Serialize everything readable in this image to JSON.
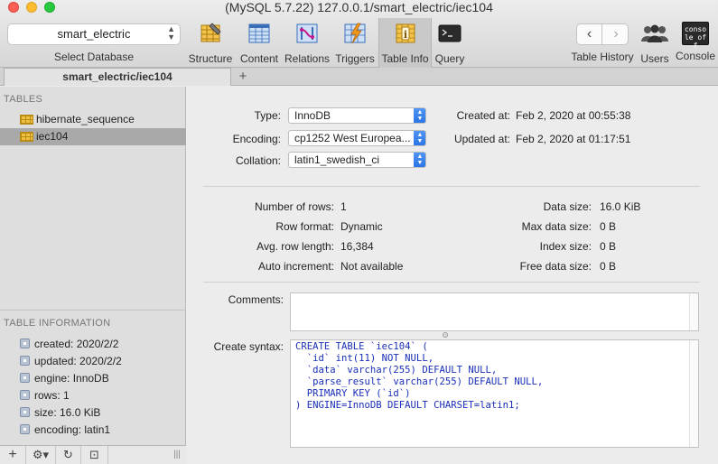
{
  "window": {
    "title": "(MySQL 5.7.22) 127.0.0.1/smart_electric/iec104"
  },
  "toolbar": {
    "database_value": "smart_electric",
    "database_caption": "Select Database",
    "items": {
      "structure": "Structure",
      "content": "Content",
      "relations": "Relations",
      "triggers": "Triggers",
      "table_info": "Table Info",
      "query": "Query",
      "table_history": "Table History",
      "users": "Users",
      "console": "Console"
    },
    "console_icon_text": "conso le off"
  },
  "tabs": {
    "active_label": "smart_electric/iec104",
    "add_label": "+"
  },
  "sidebar": {
    "tables_heading": "TABLES",
    "tables": [
      {
        "name": "hibernate_sequence"
      },
      {
        "name": "iec104"
      }
    ],
    "selected_table": "iec104",
    "info_heading": "TABLE INFORMATION",
    "info": [
      "created: 2020/2/2",
      "updated: 2020/2/2",
      "engine: InnoDB",
      "rows: 1",
      "size: 16.0 KiB",
      "encoding: latin1"
    ],
    "bottom_buttons": {
      "add": "+",
      "gear": "⚙▾",
      "refresh": "↻",
      "filter": "⊡",
      "resize": "|||"
    }
  },
  "main": {
    "type_label": "Type:",
    "type_value": "InnoDB",
    "encoding_label": "Encoding:",
    "encoding_value": "cp1252 West Europea...",
    "collation_label": "Collation:",
    "collation_value": "latin1_swedish_ci",
    "created_at_label": "Created at:",
    "created_at_value": "Feb 2, 2020 at 00:55:38",
    "updated_at_label": "Updated at:",
    "updated_at_value": "Feb 2, 2020 at 01:17:51",
    "stats_left": [
      {
        "label": "Number of rows:",
        "value": "1"
      },
      {
        "label": "Row format:",
        "value": "Dynamic"
      },
      {
        "label": "Avg. row length:",
        "value": "16,384"
      },
      {
        "label": "Auto increment:",
        "value": "Not available"
      }
    ],
    "stats_right": [
      {
        "label": "Data size:",
        "value": "16.0 KiB"
      },
      {
        "label": "Max data size:",
        "value": "0 B"
      },
      {
        "label": "Index size:",
        "value": "0 B"
      },
      {
        "label": "Free data size:",
        "value": "0 B"
      }
    ],
    "comments_label": "Comments:",
    "comments_value": "",
    "create_syntax_label": "Create syntax:",
    "create_syntax_lines": [
      "CREATE TABLE `iec104` (",
      "  `id` int(11) NOT NULL,",
      "  `data` varchar(255) DEFAULT NULL,",
      "  `parse_result` varchar(255) DEFAULT NULL,",
      "  PRIMARY KEY (`id`)",
      ") ENGINE=InnoDB DEFAULT CHARSET=latin1;"
    ]
  },
  "colors": {
    "accent": "#2a74e6",
    "selected_row": "#a9a9a9",
    "code_blue": "#1a2fb8"
  }
}
